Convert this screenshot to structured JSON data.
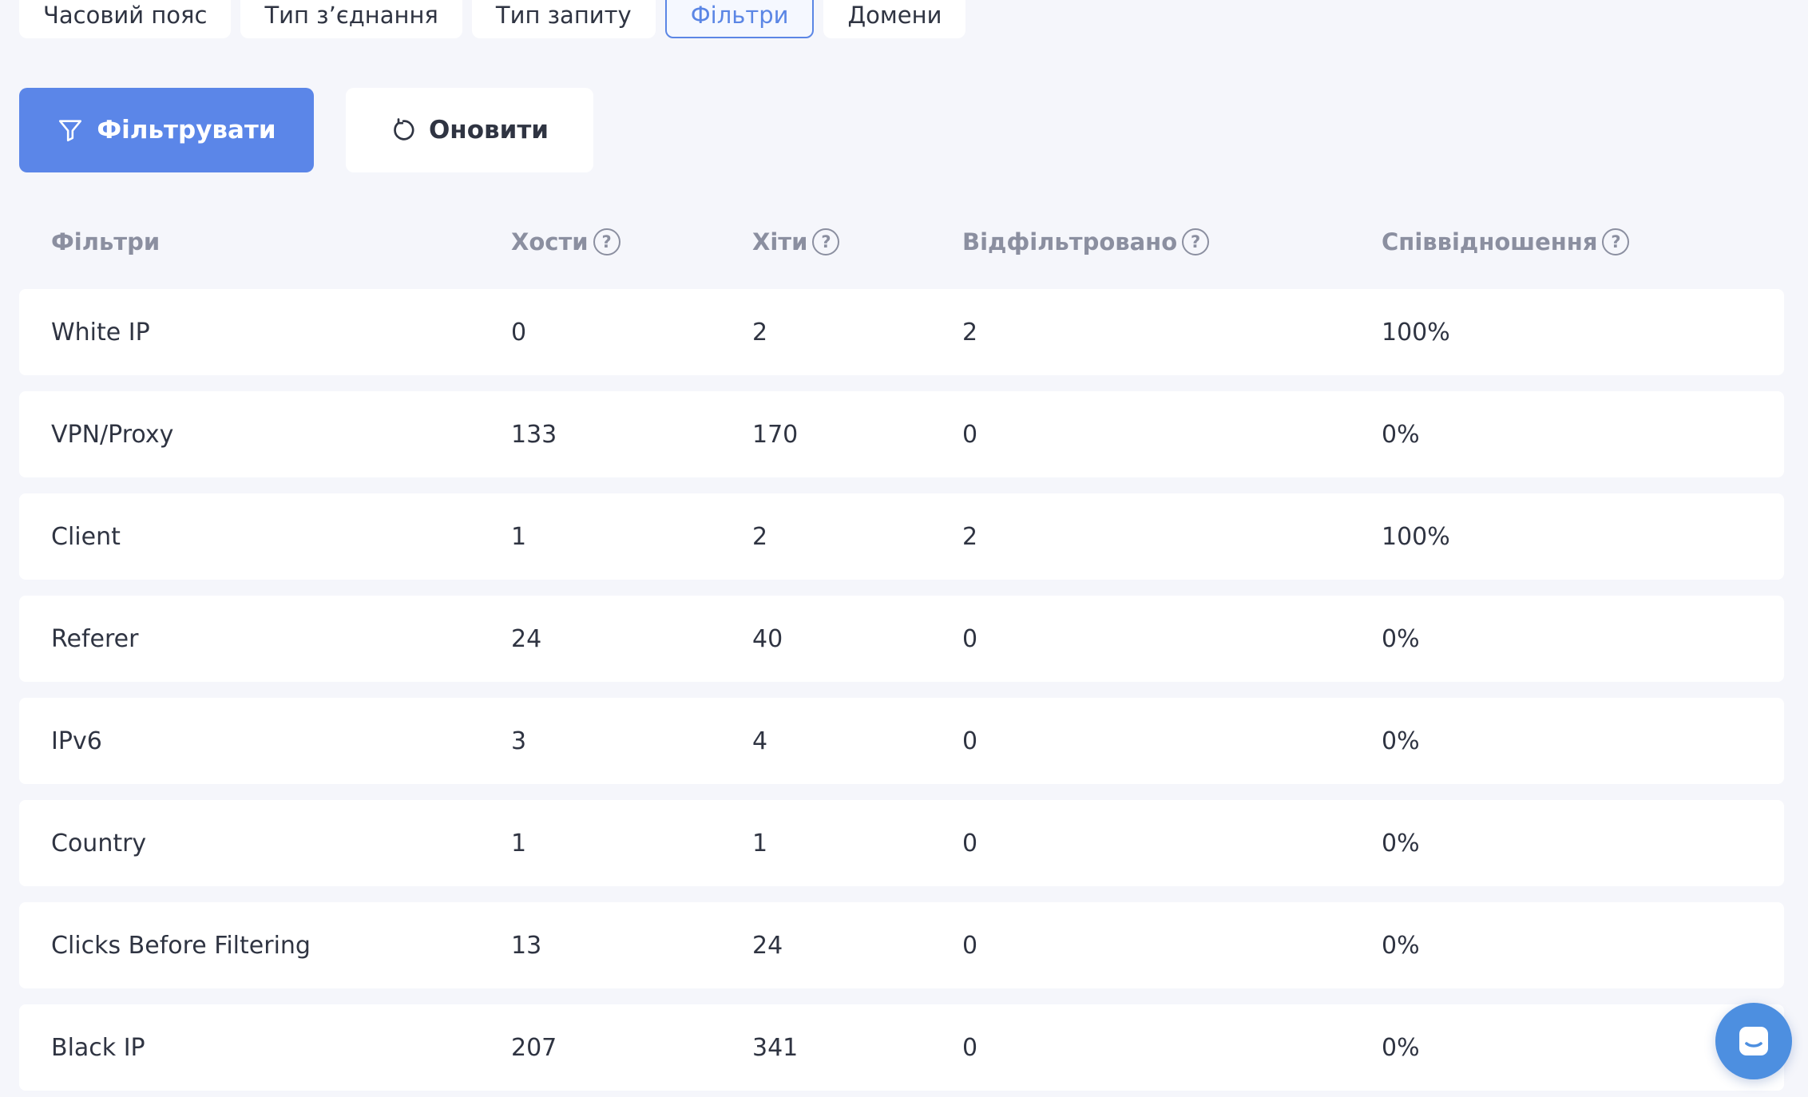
{
  "tabs": [
    {
      "label": "Часовий пояс"
    },
    {
      "label": "Тип з’єднання"
    },
    {
      "label": "Тип запиту"
    },
    {
      "label": "Фільтри",
      "active": true
    },
    {
      "label": "Домени"
    }
  ],
  "actions": {
    "filter_label": "Фільтрувати",
    "refresh_label": "Оновити"
  },
  "table": {
    "headers": {
      "filters": "Фільтри",
      "hosts": "Хости",
      "hits": "Хіти",
      "filtered": "Відфільтровано",
      "ratio": "Співвідношення"
    },
    "help_glyph": "?",
    "rows": [
      {
        "name": "White IP",
        "hosts": "0",
        "hits": "2",
        "filtered": "2",
        "ratio": "100%"
      },
      {
        "name": "VPN/Proxy",
        "hosts": "133",
        "hits": "170",
        "filtered": "0",
        "ratio": "0%"
      },
      {
        "name": "Client",
        "hosts": "1",
        "hits": "2",
        "filtered": "2",
        "ratio": "100%"
      },
      {
        "name": "Referer",
        "hosts": "24",
        "hits": "40",
        "filtered": "0",
        "ratio": "0%"
      },
      {
        "name": "IPv6",
        "hosts": "3",
        "hits": "4",
        "filtered": "0",
        "ratio": "0%"
      },
      {
        "name": "Country",
        "hosts": "1",
        "hits": "1",
        "filtered": "0",
        "ratio": "0%"
      },
      {
        "name": "Clicks Before Filtering",
        "hosts": "13",
        "hits": "24",
        "filtered": "0",
        "ratio": "0%"
      },
      {
        "name": "Black IP",
        "hosts": "207",
        "hits": "341",
        "filtered": "0",
        "ratio": "0%"
      }
    ]
  },
  "colors": {
    "accent": "#5b86e8",
    "background": "#f5f6fb",
    "header_text": "#8b8fa0",
    "chat": "#4d8fe0"
  },
  "icons": {
    "filter_button": "filter-funnel-icon",
    "refresh_button": "refresh-icon",
    "help": "question-circle-icon",
    "chat": "chat-bubble-icon"
  }
}
